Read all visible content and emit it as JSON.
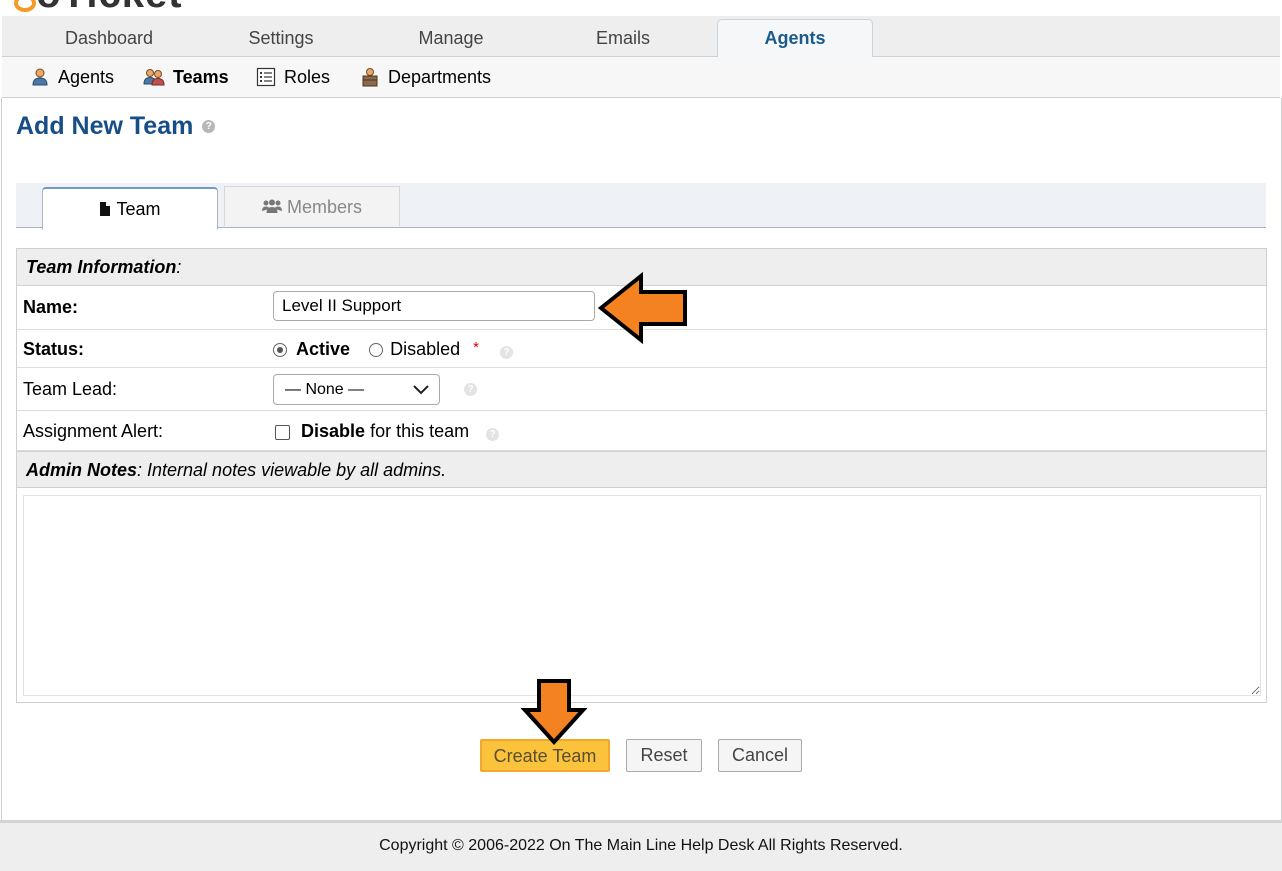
{
  "nav": {
    "tabs": [
      {
        "label": "Dashboard"
      },
      {
        "label": "Settings"
      },
      {
        "label": "Manage"
      },
      {
        "label": "Emails"
      },
      {
        "label": "Agents"
      }
    ],
    "active_tab": "Agents"
  },
  "subnav": {
    "items": [
      {
        "label": "Agents",
        "icon": "agent-icon"
      },
      {
        "label": "Teams",
        "icon": "teams-icon"
      },
      {
        "label": "Roles",
        "icon": "roles-icon"
      },
      {
        "label": "Departments",
        "icon": "departments-icon"
      }
    ],
    "active_item": "Teams"
  },
  "page": {
    "title": "Add New Team"
  },
  "tabs": [
    {
      "label": "Team",
      "icon": "document-icon"
    },
    {
      "label": "Members",
      "icon": "users-icon"
    }
  ],
  "form": {
    "section_info": {
      "title": "Team Information",
      "suffix": ":"
    },
    "name": {
      "label": "Name:",
      "value": "Level II Support"
    },
    "status": {
      "label": "Status:",
      "active_label": "Active",
      "disabled_label": "Disabled",
      "selected": "Active",
      "required_mark": "*"
    },
    "team_lead": {
      "label": "Team Lead:",
      "selected": "— None —"
    },
    "assignment_alert": {
      "label": "Assignment Alert:",
      "checkbox_bold": "Disable",
      "checkbox_rest": "for this team",
      "checked": false
    },
    "section_notes": {
      "title": "Admin Notes",
      "subtitle": ": Internal notes viewable by all admins."
    },
    "notes_value": ""
  },
  "buttons": {
    "create": "Create Team",
    "reset": "Reset",
    "cancel": "Cancel"
  },
  "footer": {
    "text": "Copyright © 2006-2022 On The Main Line Help Desk All Rights Reserved."
  },
  "colors": {
    "accent": "#184e87",
    "primary_button": "#fbc33b",
    "annotation_arrow": "#f58220"
  }
}
